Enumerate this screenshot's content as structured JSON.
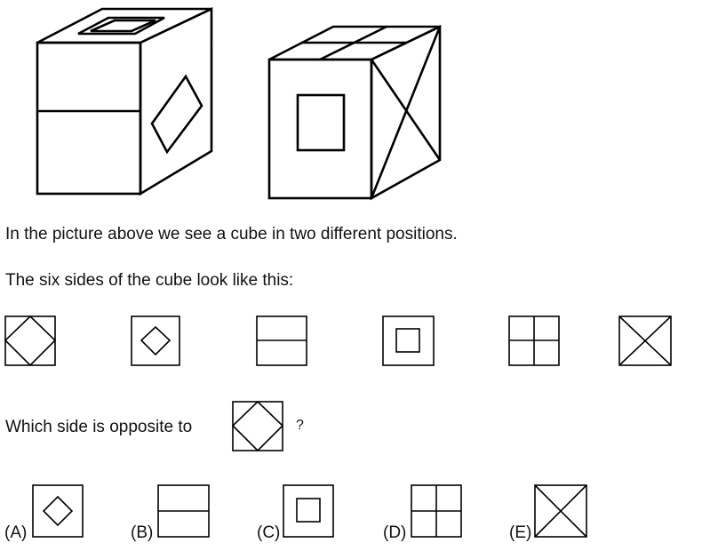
{
  "intro_text": "In the picture above we see a cube in two different positions.",
  "sides_text": "The six sides of the cube look like this:",
  "question_prefix": "Which side is opposite to",
  "question_mark": "?",
  "sides": [
    "square-with-inscribed-diamond-corners",
    "small-diamond",
    "horizontal-line",
    "inner-square",
    "four-quadrants",
    "x-cross"
  ],
  "options": [
    {
      "label": "(A)",
      "face": "small-diamond"
    },
    {
      "label": "(B)",
      "face": "horizontal-line"
    },
    {
      "label": "(C)",
      "face": "inner-square"
    },
    {
      "label": "(D)",
      "face": "four-quadrants"
    },
    {
      "label": "(E)",
      "face": "x-cross"
    }
  ]
}
